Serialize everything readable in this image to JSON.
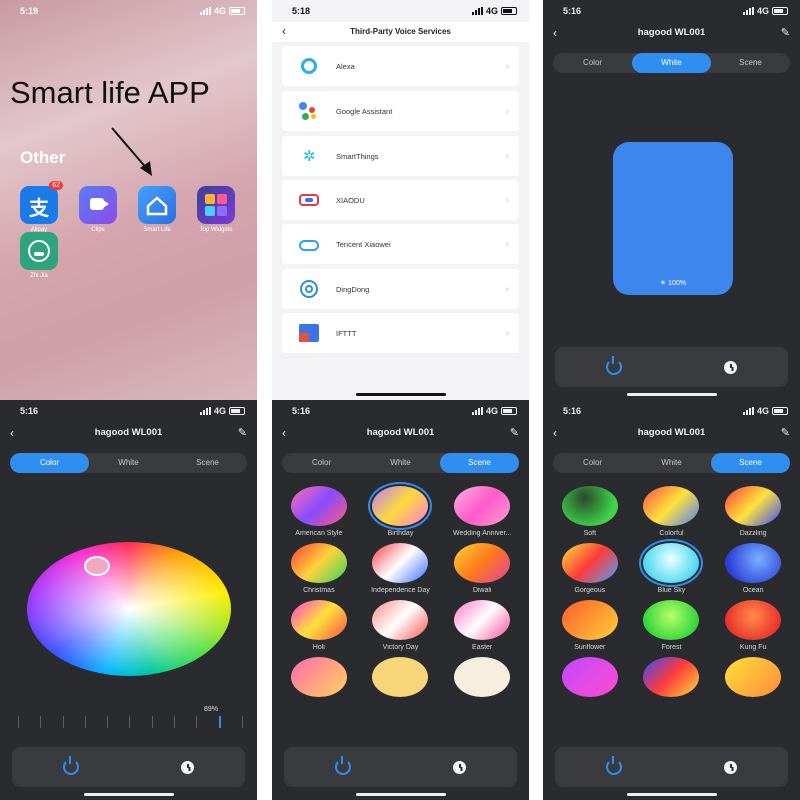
{
  "home": {
    "time": "5:19",
    "network": "4G",
    "headline": "Smart life APP",
    "folder_title": "Other",
    "apps": [
      {
        "name": "Alipay",
        "badge": "62",
        "icon": "alipay-icon",
        "color": "#1a7ae8"
      },
      {
        "name": "Clips",
        "icon": "clips-icon",
        "color": "#5b5cf0"
      },
      {
        "name": "Smart Life",
        "icon": "smart-life-icon",
        "color": "#3a8cf0"
      },
      {
        "name": "Top Widgets",
        "icon": "top-widgets-icon",
        "color": "#7e3bd8"
      },
      {
        "name": "Zhi Jia",
        "icon": "zhi-jia-icon",
        "color": "#2ea37e"
      }
    ]
  },
  "voice": {
    "time": "5:18",
    "network": "4G",
    "title": "Third-Party Voice Services",
    "services": [
      {
        "name": "Alexa",
        "icon": "alexa-icon"
      },
      {
        "name": "Google Assistant",
        "icon": "google-assistant-icon"
      },
      {
        "name": "SmartThings",
        "icon": "smartthings-icon"
      },
      {
        "name": "XIAODU",
        "icon": "xiaodu-icon"
      },
      {
        "name": "Tencent Xiaowei",
        "icon": "tencent-xiaowei-icon"
      },
      {
        "name": "DingDong",
        "icon": "dingdong-icon"
      },
      {
        "name": "IFTTT",
        "icon": "ifttt-icon"
      }
    ]
  },
  "device": {
    "title": "hagood WL001",
    "network": "4G",
    "tabs": [
      "Color",
      "White",
      "Scene"
    ],
    "accent": "#2f8ff0"
  },
  "white_panel": {
    "time": "5:16",
    "brightness": "100%"
  },
  "color_panel": {
    "time": "5:16",
    "brightness": "89%"
  },
  "scene_panel_1": {
    "time": "5:16",
    "scenes": [
      "American Style",
      "Birthday",
      "Wedding Anniver...",
      "Christmas",
      "Independence Day",
      "Diwali",
      "Holi",
      "Victory Day",
      "Easter",
      "",
      "",
      ""
    ]
  },
  "scene_panel_2": {
    "time": "5:16",
    "scenes": [
      "Soft",
      "Colorful",
      "Dazzling",
      "Gorgeous",
      "Blue Sky",
      "Ocean",
      "Sunflower",
      "Forest",
      "Kung Fu",
      "",
      "",
      ""
    ]
  }
}
